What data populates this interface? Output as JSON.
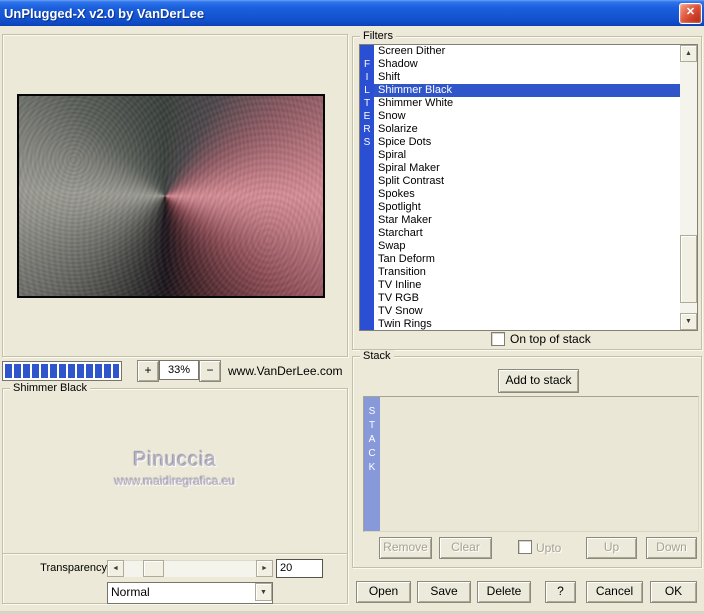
{
  "colors": {
    "dialog-bg": "#ece9d8",
    "filters-rail": "#2b4fd2",
    "stack-rail": "#8799d9",
    "selection": "#2f55c8",
    "meter-segment": "#2f55cc",
    "watermark": "#b8b4c6"
  },
  "titlebar": {
    "title": "UnPlugged-X v2.0 by VanDerLee",
    "close_glyph": "✕"
  },
  "preview": {
    "zoom_in_label": "+",
    "zoom_out_label": "−",
    "zoom_value": "33%",
    "site_label": "www.VanDerLee.com",
    "watermark_name": "Pinuccia",
    "watermark_url": "www.maidiregrafica.eu"
  },
  "filter_settings": {
    "group_label": "Shimmer Black",
    "transparency_label": "Transparency",
    "transparency_value": "20",
    "blend_mode": "Normal",
    "left_arrow_glyph": "◄",
    "right_arrow_glyph": "►",
    "dropdown_glyph": "▼"
  },
  "filters": {
    "group_label": "Filters",
    "rail_text": "FILTERS",
    "selected_item": "Shimmer Black",
    "items": [
      "Screen Dither",
      "Shadow",
      "Shift",
      "Shimmer Black",
      "Shimmer White",
      "Snow",
      "Solarize",
      "Spice Dots",
      "Spiral",
      "Spiral Maker",
      "Split Contrast",
      "Spokes",
      "Spotlight",
      "Star Maker",
      "Starchart",
      "Swap",
      "Tan Deform",
      "Transition",
      "TV Inline",
      "TV RGB",
      "TV Snow",
      "Twin Rings"
    ],
    "scroll_up_glyph": "▲",
    "scroll_down_glyph": "▼",
    "on_top_checkbox_label": "On top of stack"
  },
  "stack": {
    "group_label": "Stack",
    "rail_text": "STACK",
    "add_button_label": "Add to stack",
    "remove_label": "Remove",
    "clear_label": "Clear",
    "upto_label": "Upto",
    "up_label": "Up",
    "down_label": "Down"
  },
  "footer": {
    "open_label": "Open",
    "save_label": "Save",
    "delete_label": "Delete",
    "help_label": "?",
    "cancel_label": "Cancel",
    "ok_label": "OK"
  }
}
